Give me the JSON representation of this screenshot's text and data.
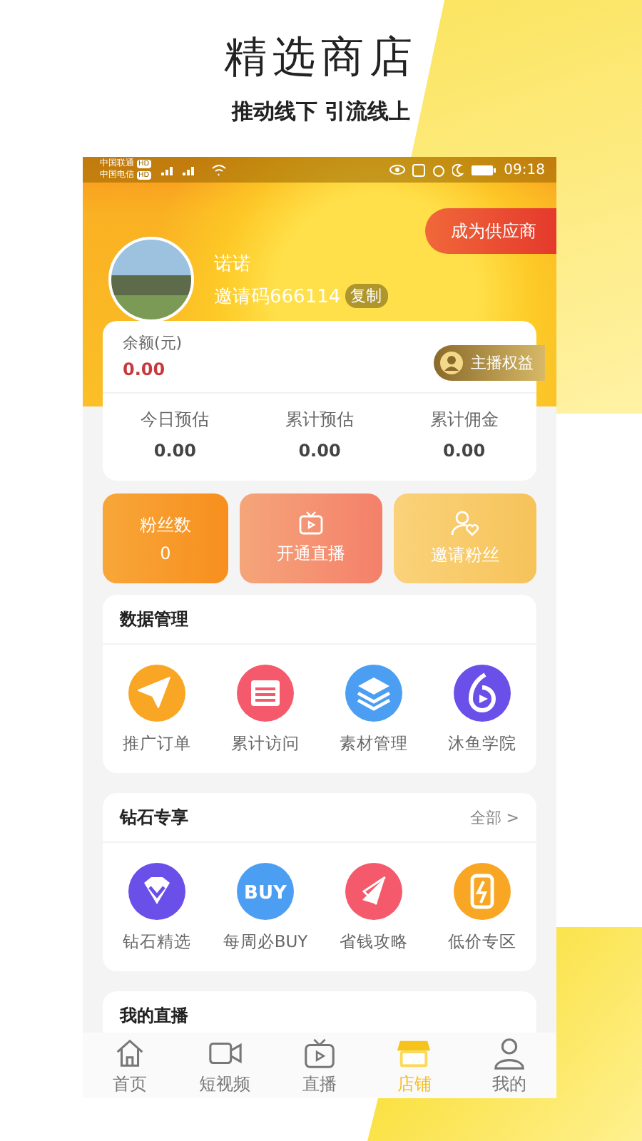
{
  "promo": {
    "title": "精选商店",
    "subtitle": "推动线下 引流线上"
  },
  "status_bar": {
    "carriers": [
      {
        "name": "中国联通",
        "badge": "HD"
      },
      {
        "name": "中国电信",
        "badge": "HD"
      }
    ],
    "time": "09:18"
  },
  "profile": {
    "supplier_button": "成为供应商",
    "name": "诺诺",
    "invite_code": "邀请码666114",
    "copy_button": "复制"
  },
  "balance": {
    "label": "余额(元)",
    "value": "0.00",
    "benefit_badge": "主播权益",
    "stats": [
      {
        "label": "今日预估",
        "value": "0.00"
      },
      {
        "label": "累计预估",
        "value": "0.00"
      },
      {
        "label": "累计佣金",
        "value": "0.00"
      }
    ]
  },
  "tiles": [
    {
      "kind": "count",
      "label": "粉丝数",
      "value": "0"
    },
    {
      "kind": "live",
      "label": "开通直播"
    },
    {
      "kind": "invite",
      "label": "邀请粉丝"
    }
  ],
  "sections": [
    {
      "title": "数据管理",
      "items": [
        {
          "kind": "plane",
          "color": "#f8a623",
          "label": "推广订单"
        },
        {
          "kind": "calendar",
          "color": "#f45a6b",
          "label": "累计访问"
        },
        {
          "kind": "layers",
          "color": "#4c9ef3",
          "label": "素材管理"
        },
        {
          "kind": "six",
          "color": "#6a4fe8",
          "label": "沐鱼学院"
        }
      ]
    },
    {
      "title": "钻石专享",
      "more": "全部 >",
      "items": [
        {
          "kind": "diamond",
          "color": "#6a4fe8",
          "label": "钻石精选"
        },
        {
          "kind": "buy",
          "color": "#4c9ef3",
          "icon_text": "BUY",
          "label": "每周必BUY"
        },
        {
          "kind": "compass",
          "color": "#f45a6b",
          "label": "省钱攻略"
        },
        {
          "kind": "phone",
          "color": "#f8a623",
          "label": "低价专区"
        }
      ]
    },
    {
      "title": "我的直播"
    }
  ],
  "nav": [
    {
      "kind": "home",
      "label": "首页",
      "selected": false
    },
    {
      "kind": "camera",
      "label": "短视频",
      "selected": false
    },
    {
      "kind": "tv",
      "label": "直播",
      "selected": false
    },
    {
      "kind": "shop",
      "label": "店铺",
      "selected": true
    },
    {
      "kind": "person",
      "label": "我的",
      "selected": false
    }
  ]
}
